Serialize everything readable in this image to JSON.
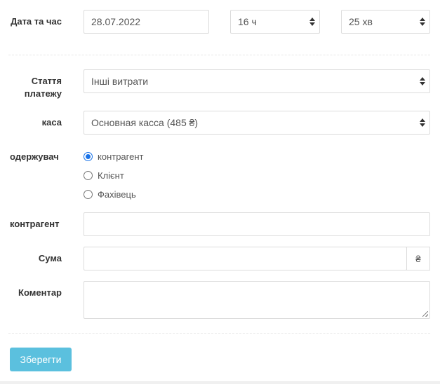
{
  "date_label": "Дата та час",
  "date_value": "28.07.2022",
  "hour_value": "16 ч",
  "minute_value": "25 хв",
  "article_label": "Стаття платежу",
  "article_value": "Інші витрати",
  "cash_label": "каса",
  "cash_value": "Основная касса (485 ₴)",
  "recipient_label": "одержувач",
  "recipient_options": [
    "контрагент",
    "Клієнт",
    "Фахівець"
  ],
  "recipient_selected": "контрагент",
  "counterparty_label": "контрагент",
  "counterparty_value": "",
  "amount_label": "Сума",
  "amount_value": "",
  "currency_symbol": "₴",
  "comment_label": "Коментар",
  "comment_value": "",
  "save_label": "Зберегти",
  "accent_color": "#5bc0de",
  "radio_color": "#1a73e8"
}
